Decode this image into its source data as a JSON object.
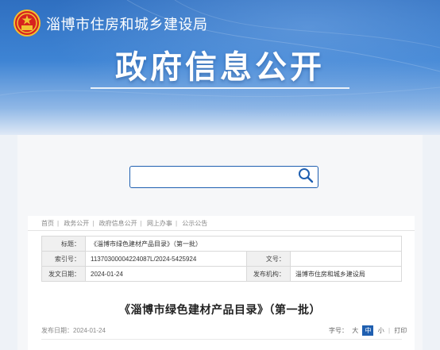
{
  "header": {
    "site_name": "淄博市住房和城乡建设局",
    "section_title": "政府信息公开",
    "brand_colors": {
      "blue": "#2f6fc0",
      "emblem_red": "#d7231e"
    }
  },
  "search": {
    "value": "",
    "placeholder": ""
  },
  "breadcrumb": [
    "首页",
    "政务公开",
    "政府信息公开",
    "网上办事",
    "公示公告"
  ],
  "meta": {
    "title_label": "标题：",
    "title_value": "《淄博市绿色建材产品目录》（第一批）",
    "index_label": "索引号：",
    "index_value": "11370300004224087L/2024-5425924",
    "doc_no_label": "文号：",
    "doc_no_value": "",
    "date_label": "发文日期：",
    "date_value": "2024-01-24",
    "org_label": "发布机构：",
    "org_value": "淄博市住房和城乡建设局"
  },
  "article": {
    "title": "《淄博市绿色建材产品目录》（第一批）",
    "publish_label": "发布日期：",
    "publish_date": "2024-01-24"
  },
  "tools": {
    "font_size_label": "字号：",
    "size_large": "大",
    "size_medium": "中",
    "size_small": "小",
    "print": "打印"
  }
}
